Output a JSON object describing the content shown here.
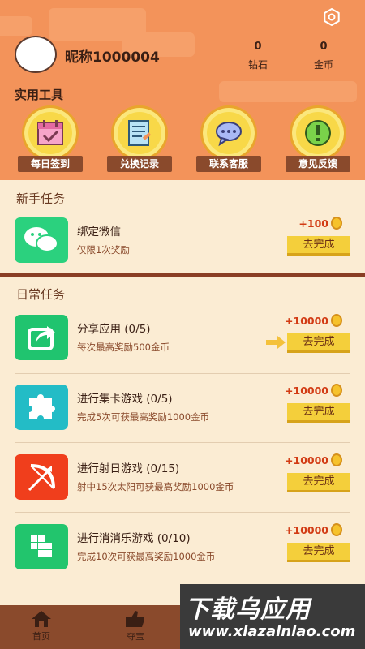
{
  "profile": {
    "nickname": "昵称1000004"
  },
  "stats": [
    {
      "value": "0",
      "label": "钻石"
    },
    {
      "value": "0",
      "label": "金币"
    }
  ],
  "tools": {
    "title": "实用工具",
    "items": [
      {
        "label": "每日签到",
        "icon": "calendar-check-icon"
      },
      {
        "label": "兑换记录",
        "icon": "receipt-icon"
      },
      {
        "label": "联系客服",
        "icon": "chat-bubble-icon"
      },
      {
        "label": "意见反馈",
        "icon": "exclamation-icon"
      }
    ]
  },
  "newbie": {
    "title": "新手任务",
    "tasks": [
      {
        "name": "绑定微信",
        "desc": "仅限1次奖励",
        "reward": "+100",
        "button": "去完成",
        "icon": "wechat-icon",
        "color": "#2bd17e"
      }
    ]
  },
  "daily": {
    "title": "日常任务",
    "tasks": [
      {
        "name": "分享应用 (0/5)",
        "desc": "每次最高奖励500金币",
        "reward": "+10000",
        "button": "去完成",
        "icon": "share-icon",
        "color": "#20c46f"
      },
      {
        "name": "进行集卡游戏 (0/5)",
        "desc": "完成5次可获最高奖励1000金币",
        "reward": "+10000",
        "button": "去完成",
        "icon": "puzzle-icon",
        "color": "#23bcc6"
      },
      {
        "name": "进行射日游戏 (0/15)",
        "desc": "射中15次太阳可获最高奖励1000金币",
        "reward": "+10000",
        "button": "去完成",
        "icon": "bow-icon",
        "color": "#f03e1c"
      },
      {
        "name": "进行消消乐游戏 (0/10)",
        "desc": "完成10次可获最高奖励1000金币",
        "reward": "+10000",
        "button": "去完成",
        "icon": "blocks-icon",
        "color": "#22c56d"
      }
    ]
  },
  "nav": [
    {
      "label": "首页",
      "icon": "home-icon"
    },
    {
      "label": "夺宝",
      "icon": "thumbs-up-icon"
    }
  ],
  "watermark": {
    "title": "下载乌应用",
    "url": "www.xlazalnlao.com"
  },
  "colors": {
    "header": "#f3935a",
    "background": "#fbecd3",
    "button": "#f4cf3b",
    "reward": "#d23b14",
    "nav": "#8a4a2c"
  }
}
